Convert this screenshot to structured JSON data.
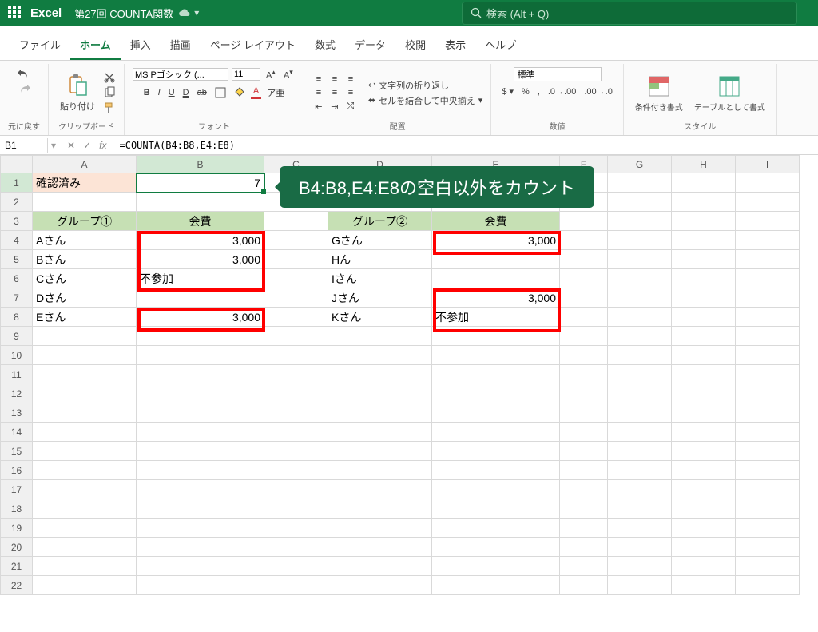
{
  "title": {
    "app": "Excel",
    "doc": "第27回 COUNTA関数"
  },
  "search": {
    "placeholder": "検索 (Alt + Q)"
  },
  "tabs": [
    "ファイル",
    "ホーム",
    "挿入",
    "描画",
    "ページ レイアウト",
    "数式",
    "データ",
    "校閲",
    "表示",
    "ヘルプ"
  ],
  "active_tab": 1,
  "ribbon": {
    "undo_label": "元に戻す",
    "clipboard": {
      "paste": "貼り付け",
      "label": "クリップボード"
    },
    "font": {
      "name": "MS Pゴシック (...",
      "size": "11",
      "buttons": {
        "b": "B",
        "i": "I",
        "u": "U",
        "d": "D"
      },
      "label": "フォント"
    },
    "align": {
      "wrap": "文字列の折り返し",
      "merge": "セルを結合して中央揃え",
      "label": "配置"
    },
    "number": {
      "format": "標準",
      "label": "数値"
    },
    "styles": {
      "cond": "条件付き書式",
      "table": "テーブルとして書式",
      "label": "スタイル"
    }
  },
  "formula_bar": {
    "ref": "B1",
    "formula": "=COUNTA(B4:B8,E4:E8)"
  },
  "columns": [
    "A",
    "B",
    "C",
    "D",
    "E",
    "F",
    "G",
    "H",
    "I"
  ],
  "sheet": {
    "A1": "確認済み",
    "B1": "7",
    "A3": "グループ①",
    "B3": "会費",
    "D3": "グループ②",
    "E3": "会費",
    "A4": "Aさん",
    "B4": "3,000",
    "D4": "Gさん",
    "E4": "3,000",
    "A5": "Bさん",
    "B5": "3,000",
    "D5": "Hん",
    "A6": "Cさん",
    "B6": "不参加",
    "D6": "Iさん",
    "A7": "Dさん",
    "D7": "Jさん",
    "E7": "3,000",
    "A8": "Eさん",
    "B8": "3,000",
    "D8": "Kさん",
    "E8": "不参加"
  },
  "callout": "B4:B8,E4:E8の空白以外をカウント",
  "chart_data": {
    "type": "table",
    "title": "COUNTA example — count non-blank cells in B4:B8 and E4:E8",
    "result_cell": "B1",
    "result_value": 7,
    "ranges": [
      {
        "name": "グループ①",
        "members": [
          "Aさん",
          "Bさん",
          "Cさん",
          "Dさん",
          "Eさん"
        ],
        "会費": [
          "3,000",
          "3,000",
          "不参加",
          "",
          "3,000"
        ]
      },
      {
        "name": "グループ②",
        "members": [
          "Gさん",
          "Hん",
          "Iさん",
          "Jさん",
          "Kさん"
        ],
        "会費": [
          "3,000",
          "",
          "",
          "3,000",
          "不参加"
        ]
      }
    ]
  }
}
